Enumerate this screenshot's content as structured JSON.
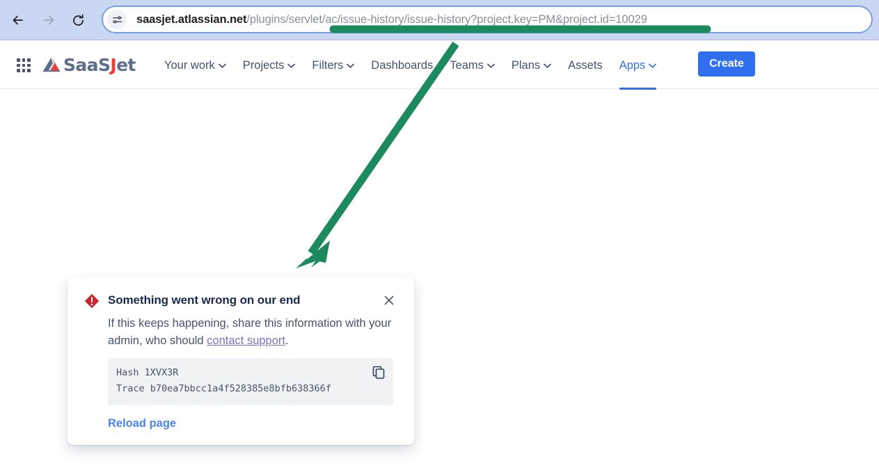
{
  "browser": {
    "back_label": "Back",
    "forward_label": "Forward",
    "reload_label": "Reload this page",
    "site_info_label": "View site information",
    "url_host": "saasjet.atlassian.net",
    "url_path": "/plugins/servlet/ac/issue-history/issue-history?project.key=PM&project.id=10029",
    "url_full": "saasjet.atlassian.net/plugins/servlet/ac/issue-history/issue-history?project.key=PM&project.id=10029",
    "chrome_bg": "#c9d7f2"
  },
  "jira_nav": {
    "app_switcher_label": "App switcher",
    "brand": {
      "part_a": "SaaS",
      "part_b": "J",
      "part_c": "et",
      "logo_icon": "saasjet-triangle-icon",
      "color_slate": "#5d6f8c",
      "color_red": "#ef3e33"
    },
    "items": [
      {
        "label": "Your work",
        "has_caret": true,
        "active": false
      },
      {
        "label": "Projects",
        "has_caret": true,
        "active": false
      },
      {
        "label": "Filters",
        "has_caret": true,
        "active": false
      },
      {
        "label": "Dashboards",
        "has_caret": false,
        "active": false
      },
      {
        "label": "Teams",
        "has_caret": true,
        "active": false
      },
      {
        "label": "Plans",
        "has_caret": true,
        "active": false
      },
      {
        "label": "Assets",
        "has_caret": false,
        "active": false
      },
      {
        "label": "Apps",
        "has_caret": true,
        "active": true
      }
    ],
    "create_label": "Create",
    "accent_blue": "#2f6fed"
  },
  "error_dialog": {
    "icon": "error-diamond-icon",
    "title": "Something went wrong on our end",
    "close_label": "Close",
    "body_prefix": "If this keeps happening, share this information with your admin, who should ",
    "body_link": "contact support",
    "body_suffix": ".",
    "hash_label": "Hash",
    "hash_value": "1XVX3R",
    "trace_label": "Trace",
    "trace_value": "b70ea7bbcc1a4f528385e8bfb638366f",
    "copy_label": "Copy",
    "reload_label": "Reload page",
    "error_color": "#c9252d",
    "link_color": "#7b6fc4",
    "reload_color": "#4b86f0"
  },
  "annotation": {
    "color": "#1c8a5e",
    "underline_label": "url-highlight-bar",
    "arrow_label": "pointer-arrow-to-error-dialog"
  }
}
